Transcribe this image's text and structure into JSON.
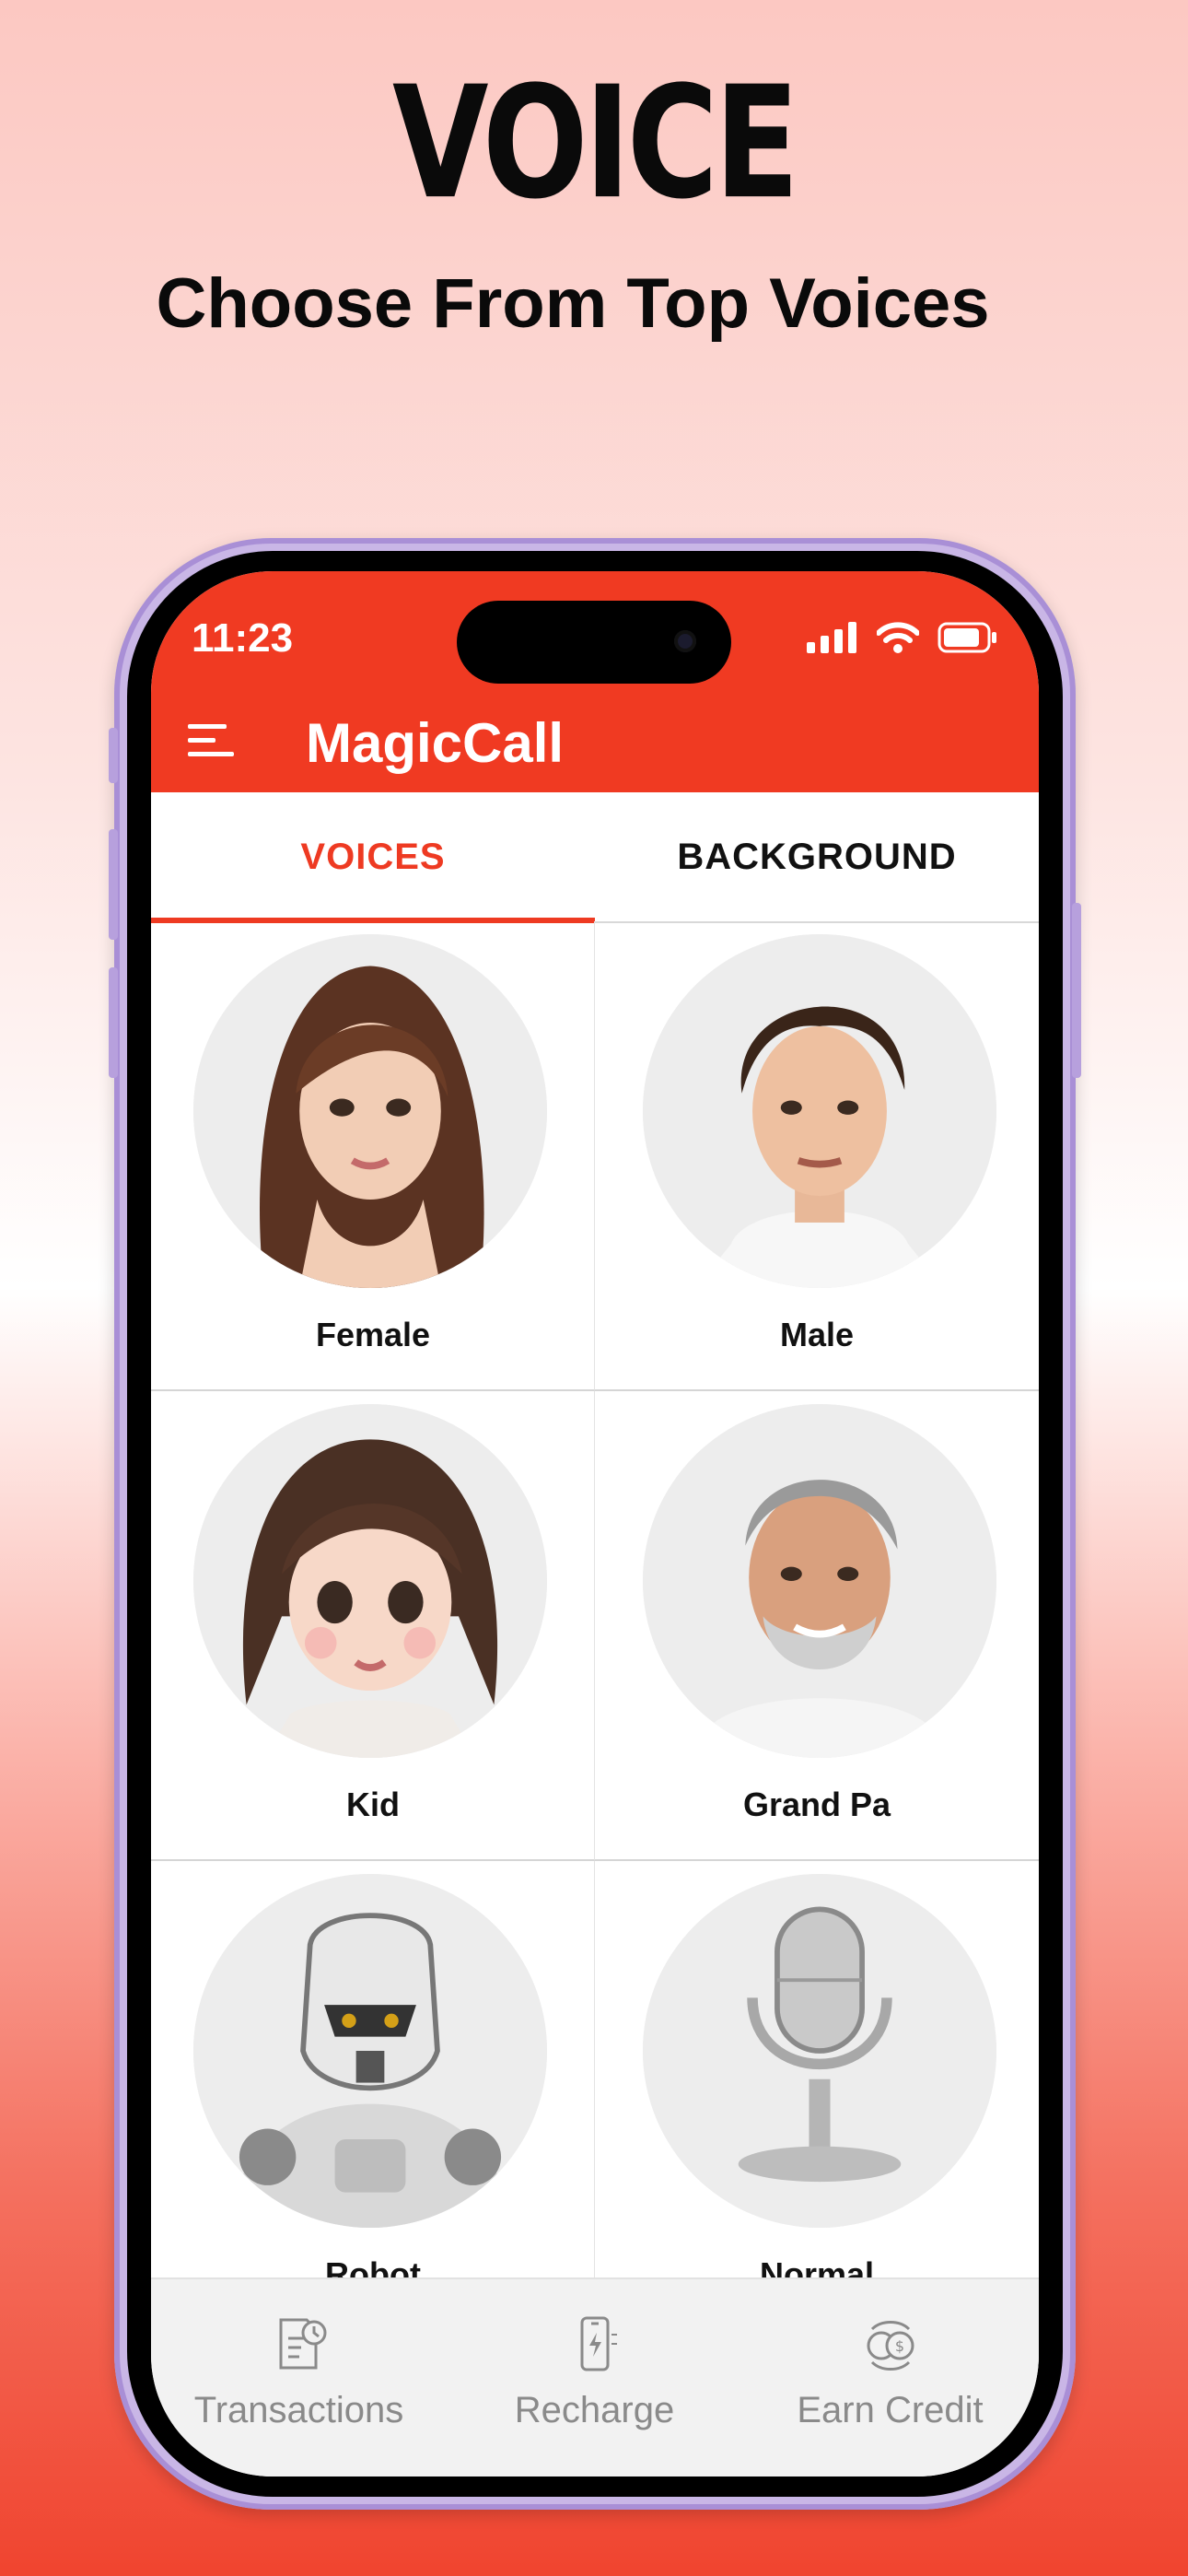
{
  "hero": {
    "title": "VOICE",
    "subtitle": "Choose From Top Voices"
  },
  "status_bar": {
    "time": "11:23"
  },
  "app_bar": {
    "title": "MagicCall",
    "menu_icon": "hamburger-menu-icon"
  },
  "tabs": [
    {
      "label": "VOICES",
      "selected": true
    },
    {
      "label": "BACKGROUND",
      "selected": false
    }
  ],
  "voices": [
    {
      "label": "Female",
      "image": "female-avatar"
    },
    {
      "label": "Male",
      "image": "male-avatar"
    },
    {
      "label": "Kid",
      "image": "kid-avatar"
    },
    {
      "label": "Grand Pa",
      "image": "grandpa-avatar"
    },
    {
      "label": "Robot",
      "image": "robot-avatar"
    },
    {
      "label": "Normal",
      "image": "microphone-avatar"
    }
  ],
  "bottom_nav": [
    {
      "label": "Transactions",
      "icon": "receipt-clock-icon"
    },
    {
      "label": "Recharge",
      "icon": "phone-charge-icon"
    },
    {
      "label": "Earn Credit",
      "icon": "coins-exchange-icon"
    }
  ],
  "colors": {
    "accent": "#f03a22",
    "tab_active": "#ee3a22",
    "nav_text": "#8a8a8a"
  }
}
